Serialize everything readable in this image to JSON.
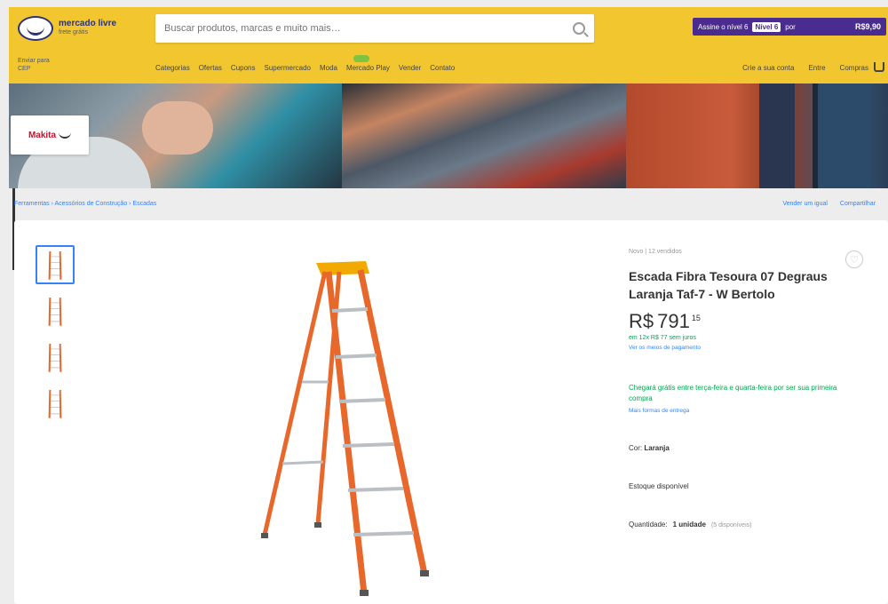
{
  "header": {
    "logo_title": "mercado livre",
    "logo_subtitle": "frete grátis",
    "search_placeholder": "Buscar produtos, marcas e muito mais…",
    "promo": {
      "text": "Assine o nível 6",
      "badge": "Nível 6",
      "note": "por",
      "price": "R$9,90"
    },
    "location": [
      "Enviar para",
      "CEP"
    ],
    "nav": [
      "Categorias",
      "Ofertas",
      "Cupons",
      "Supermercado",
      "Moda",
      "Mercado Play",
      "Vender",
      "Contato"
    ],
    "account_nav": [
      "Crie a sua conta",
      "Entre",
      "Compras"
    ]
  },
  "banner": {
    "brand_tag": "Makita"
  },
  "breadcrumbs": {
    "path": "Ferramentas › Acessórios de Construção › Escadas",
    "right": [
      "Vender um igual",
      "Compartilhar"
    ]
  },
  "product": {
    "meta": "Novo | 12 vendidos",
    "title": "Escada Fibra Tesoura 07 Degraus Laranja Taf-7 - W Bertolo",
    "currency": "R$",
    "price": "791",
    "cents": "15",
    "installments": "em 12x R$ 77 sem juros",
    "installments_link": "Ver os meios de pagamento",
    "shipping": "Chegará grátis entre terça-feira e quarta-feira por ser sua primeira compra",
    "shipping_link": "Mais formas de entrega",
    "color_label": "Cor:",
    "color_value": "Laranja",
    "stock": "Estoque disponível",
    "qty_label": "Quantidade:",
    "qty_value": "1 unidade",
    "qty_note": "(5 disponíveis)"
  },
  "colors": {
    "header_bg": "#f2c62f",
    "ladder_orange": "#e8672a",
    "link_blue": "#3483fa",
    "success_green": "#00a650"
  }
}
